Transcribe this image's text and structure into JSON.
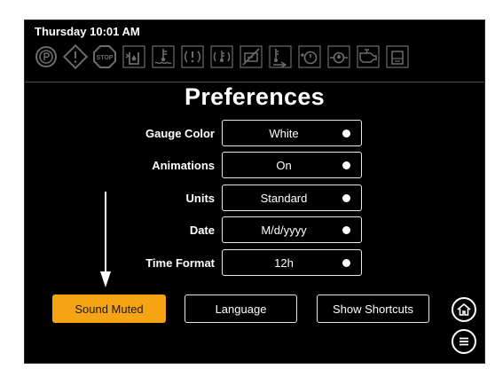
{
  "status": {
    "clock": "Thursday 10:01 AM"
  },
  "indicators": [
    {
      "icon": "parking-brake-icon",
      "color": "#6c6c6c"
    },
    {
      "icon": "warning-triangle-icon",
      "color": "#6c6c6c"
    },
    {
      "icon": "stop-icon",
      "color": "#6c6c6c"
    },
    {
      "icon": "coolant-level-icon",
      "color": "#6c6c6c"
    },
    {
      "icon": "coolant-temp-icon",
      "color": "#6c6c6c"
    },
    {
      "icon": "transmission-warning-icon",
      "color": "#6c6c6c"
    },
    {
      "icon": "transmission-temp-icon",
      "color": "#6c6c6c"
    },
    {
      "icon": "dpf-regen-inhibit-icon",
      "color": "#6c6c6c"
    },
    {
      "icon": "exhaust-temp-icon",
      "color": "#6c6c6c"
    },
    {
      "icon": "oil-pressure-icon",
      "color": "#6c6c6c"
    },
    {
      "icon": "oil-level-icon",
      "color": "#6c6c6c"
    },
    {
      "icon": "engine-check-icon",
      "color": "#6c6c6c"
    },
    {
      "icon": "fuel-filter-icon",
      "color": "#6c6c6c"
    }
  ],
  "page": {
    "title": "Preferences"
  },
  "preferences": [
    {
      "label": "Gauge Color",
      "value": "White"
    },
    {
      "label": "Animations",
      "value": "On"
    },
    {
      "label": "Units",
      "value": "Standard"
    },
    {
      "label": "Date",
      "value": "M/d/yyyy"
    },
    {
      "label": "Time Format",
      "value": "12h"
    }
  ],
  "actions": {
    "sound": "Sound Muted",
    "language": "Language",
    "shortcuts": "Show Shortcuts"
  },
  "nav": {
    "home_icon": "home-icon",
    "menu_icon": "menu-icon"
  },
  "colors": {
    "accent": "#f7a414",
    "background": "#000000",
    "indicator_dim": "#6c6c6c"
  }
}
